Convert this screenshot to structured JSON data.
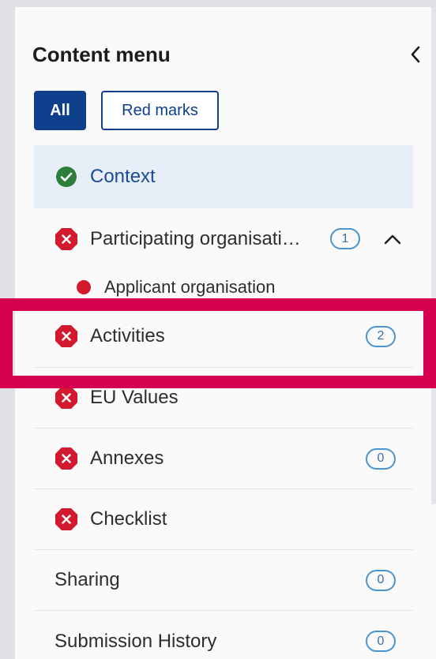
{
  "header": {
    "title": "Content menu",
    "collapse_icon": "chevron-left-icon"
  },
  "filters": {
    "all_label": "All",
    "red_marks_label": "Red marks"
  },
  "colors": {
    "accent": "#0e3f8c",
    "error": "#d3192d",
    "success": "#2f7d3b",
    "highlight": "#d6004f",
    "badge_border": "#4a94cf"
  },
  "menu": {
    "items": [
      {
        "label": "Context",
        "status": "check-circle-icon",
        "active": true
      },
      {
        "label": "Participating organisati…",
        "status": "error-octagon-icon",
        "count": "1",
        "expanded": true,
        "children": [
          {
            "label": "Applicant organisation",
            "status": "red-dot-icon"
          }
        ]
      },
      {
        "label": "Activities",
        "status": "error-octagon-icon",
        "count": "2",
        "highlighted": true
      },
      {
        "label": "EU Values",
        "status": "error-octagon-icon"
      },
      {
        "label": "Annexes",
        "status": "error-octagon-icon",
        "count": "0"
      },
      {
        "label": "Checklist",
        "status": "error-octagon-icon"
      },
      {
        "label": "Sharing",
        "count": "0"
      },
      {
        "label": "Submission History",
        "count": "0"
      }
    ]
  }
}
